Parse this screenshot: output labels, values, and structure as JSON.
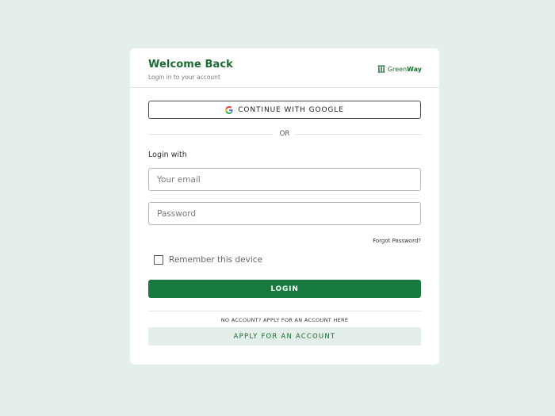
{
  "header": {
    "title": "Welcome Back",
    "subtitle": "Login in to your account",
    "brand": {
      "name_light": "Green",
      "name_bold": "Way",
      "icon": "greenway-logo-icon"
    }
  },
  "google": {
    "label": "CONTINUE WITH GOOGLE",
    "icon": "google-icon"
  },
  "divider": {
    "text": "OR"
  },
  "form": {
    "login_with_label": "Login with",
    "email": {
      "placeholder": "Your email",
      "value": ""
    },
    "password": {
      "placeholder": "Password",
      "value": ""
    },
    "forgot_password": "Forgot Password?",
    "remember_label": "Remember this device",
    "remember_checked": false,
    "login_button": "LOGIN"
  },
  "footer": {
    "no_account_text": "NO ACCOUNT? APPLY FOR AN ACCOUNT HERE",
    "apply_button": "APPLY FOR AN ACCOUNT"
  },
  "colors": {
    "background": "#e4eeea",
    "primary": "#187a3e",
    "brand_text": "#1b6b33"
  }
}
